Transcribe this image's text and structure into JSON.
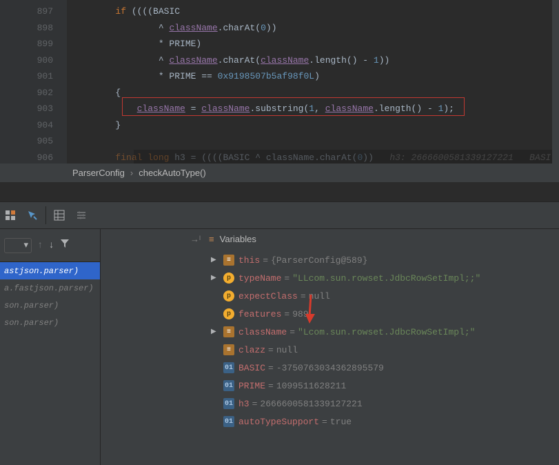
{
  "gutter": [
    "897",
    "898",
    "899",
    "900",
    "901",
    "902",
    "903",
    "904",
    "905",
    "906"
  ],
  "code": {
    "l897": {
      "if": "if",
      "basic": "BASIC"
    },
    "l898": {
      "cn": "className",
      "charAt": ".charAt(",
      "zero": "0",
      "close": "))"
    },
    "l899": {
      "prime": "* PRIME)"
    },
    "l900": {
      "caret": "^ ",
      "cn": "className",
      "charAt": ".charAt(",
      "cn2": "className",
      "len": ".length() - ",
      "one": "1",
      "close": "))"
    },
    "l901": {
      "prime": "* PRIME == ",
      "hex": "0x9198507b5af98f0L",
      "close": ")"
    },
    "l902": {
      "brace": "{"
    },
    "l903": {
      "cn1": "className",
      "eq": " = ",
      "cn2": "className",
      "sub": ".substring(",
      "one": "1",
      "comma": ", ",
      "cn3": "className",
      "len": ".length() - ",
      "one2": "1",
      "close": ");"
    },
    "l904": {
      "brace": "}"
    },
    "l906": {
      "final": "final long",
      "h3": " h3 = ((((BASIC ^ className.charAt(",
      "zero": "0",
      "tail": "))   ",
      "hint": "h3: 2666600581339127221   BASI"
    }
  },
  "breadcrumb": {
    "a": "ParserConfig",
    "b": "checkAutoType()"
  },
  "varsHeader": "Variables",
  "frames": {
    "it0": "astjson.parser)",
    "it1": "a.fastjson.parser)",
    "it2": "son.parser)",
    "it3": "son.parser)"
  },
  "variables": {
    "this": {
      "name": "this",
      "eq": "=",
      "val": "{ParserConfig@589}"
    },
    "typeName": {
      "name": "typeName",
      "eq": "=",
      "val": "\"LLcom.sun.rowset.JdbcRowSetImpl;;\""
    },
    "expectClass": {
      "name": "expectClass",
      "eq": "=",
      "val": "null"
    },
    "features": {
      "name": "features",
      "eq": "=",
      "val": "989"
    },
    "className": {
      "name": "className",
      "eq": "=",
      "val": "\"Lcom.sun.rowset.JdbcRowSetImpl;\""
    },
    "clazz": {
      "name": "clazz",
      "eq": "=",
      "val": "null"
    },
    "BASIC": {
      "name": "BASIC",
      "eq": "=",
      "val": "-3750763034362895579"
    },
    "PRIME": {
      "name": "PRIME",
      "eq": "=",
      "val": "1099511628211"
    },
    "h3": {
      "name": "h3",
      "eq": "=",
      "val": "2666600581339127221"
    },
    "autoTypeSupport": {
      "name": "autoTypeSupport",
      "eq": "=",
      "val": "true"
    }
  }
}
